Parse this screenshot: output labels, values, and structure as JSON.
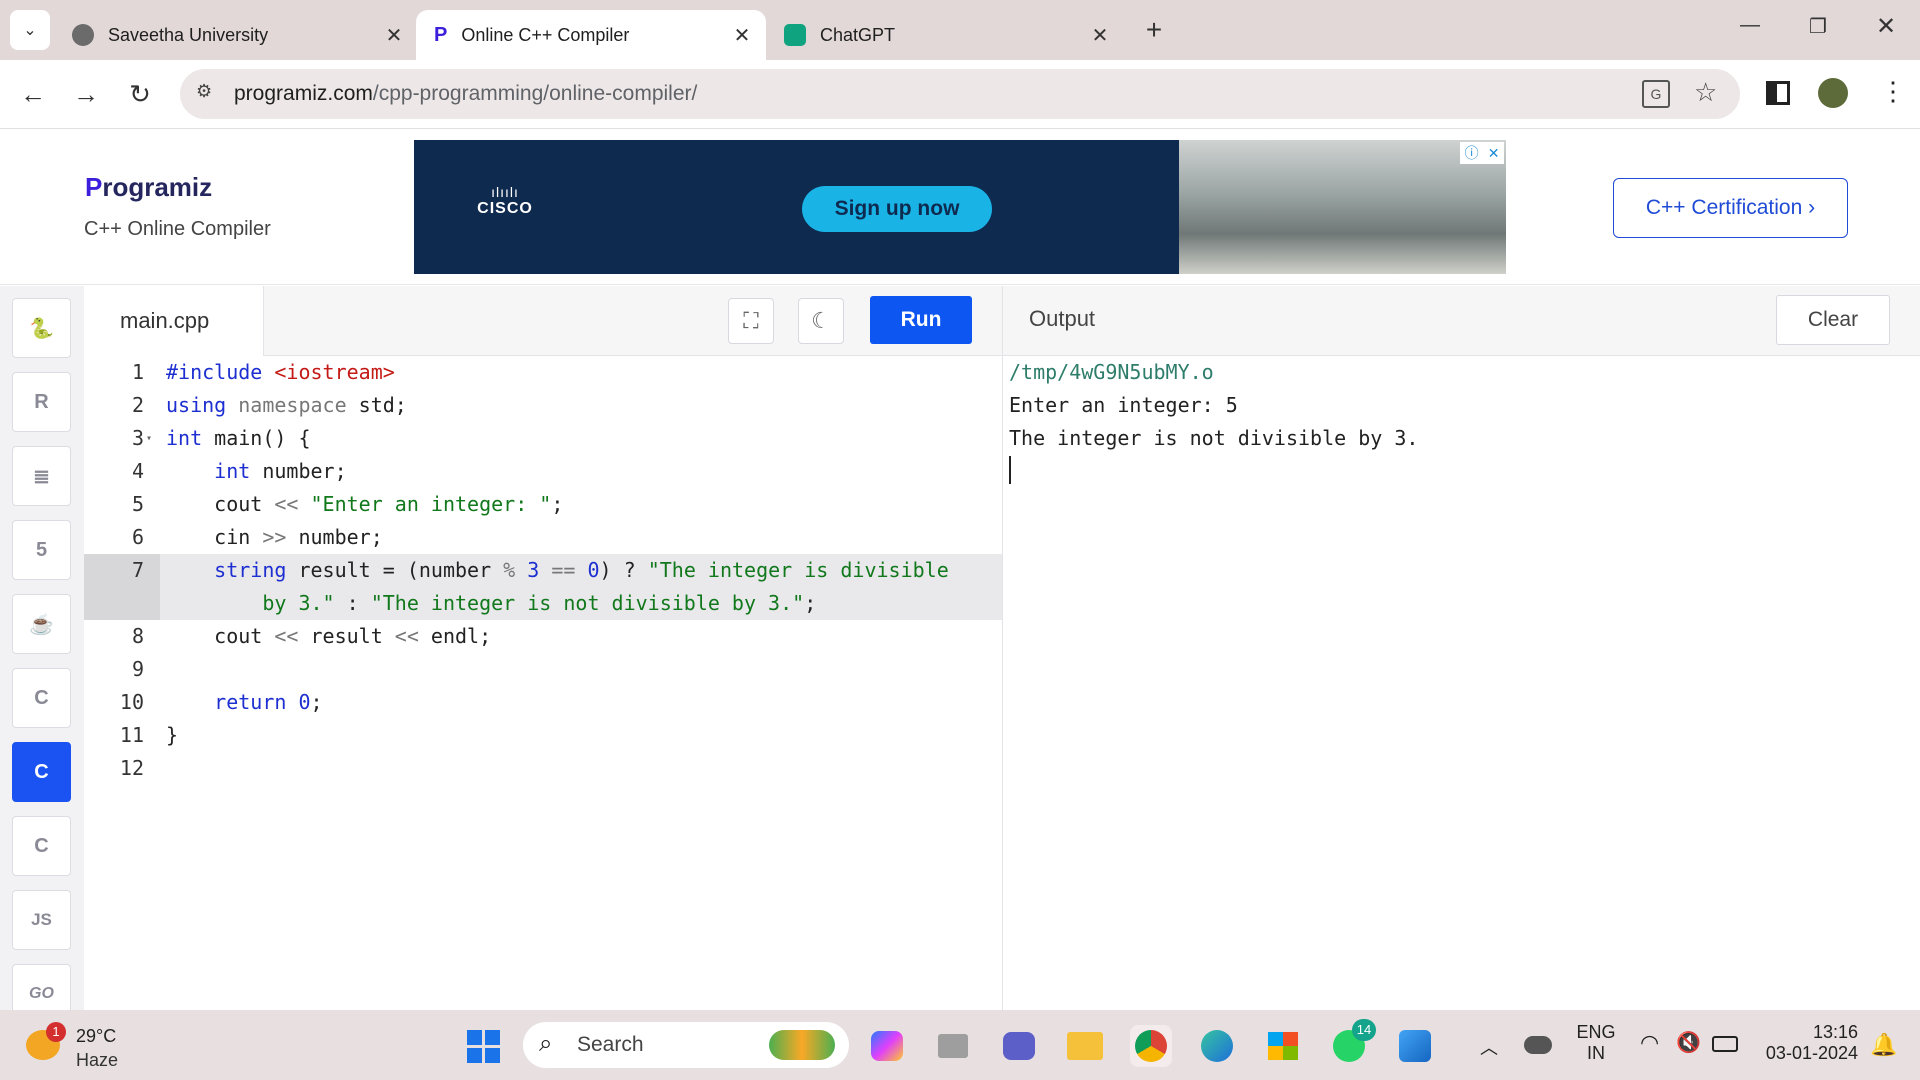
{
  "browser": {
    "tabs": [
      {
        "title": "Saveetha University",
        "active": false
      },
      {
        "title": "Online C++ Compiler",
        "active": true
      },
      {
        "title": "ChatGPT",
        "active": false
      }
    ],
    "url_host": "programiz.com",
    "url_path": "/cpp-programming/online-compiler/"
  },
  "header": {
    "brand": "rogramiz",
    "brand_p": "P",
    "subtitle": "C++ Online Compiler",
    "ad_logo": "CISCO",
    "ad_button": "Sign up now",
    "certification": "C++ Certification ›"
  },
  "rail": {
    "items": [
      "python-icon",
      "r-icon",
      "sql-icon",
      "html5-icon",
      "java-icon",
      "c-icon",
      "cpp-icon",
      "csharp-icon",
      "js-icon",
      "go-icon"
    ],
    "js_label": "JS",
    "go_label": "GO"
  },
  "editor": {
    "file_name": "main.cpp",
    "run_label": "Run",
    "line_numbers": [
      "1",
      "2",
      "3",
      "4",
      "5",
      "6",
      "7",
      "8",
      "9",
      "10",
      "11",
      "12"
    ],
    "lines": [
      "#include <iostream>",
      "using namespace std;",
      "int main() {",
      "    int number;",
      "    cout << \"Enter an integer: \";",
      "    cin >> number;",
      "    string result = (number % 3 == 0) ? \"The integer is divisible",
      "        by 3.\" : \"The integer is not divisible by 3.\";",
      "    cout << result << endl;",
      "",
      "    return 0;",
      "}",
      ""
    ]
  },
  "output": {
    "title": "Output",
    "clear_label": "Clear",
    "lines": [
      "/tmp/4wG9N5ubMY.o",
      "Enter an integer: 5",
      "The integer is not divisible by 3."
    ]
  },
  "taskbar": {
    "weather_temp": "29°C",
    "weather_desc": "Haze",
    "weather_badge": "1",
    "search_placeholder": "Search",
    "whatsapp_badge": "14",
    "lang_top": "ENG",
    "lang_bottom": "IN",
    "time": "13:16",
    "date": "03-01-2024"
  },
  "colors": {
    "accent": "#0d56f2",
    "keyword": "#1d2fd0",
    "string": "#11781b",
    "include": "#c41a16"
  }
}
